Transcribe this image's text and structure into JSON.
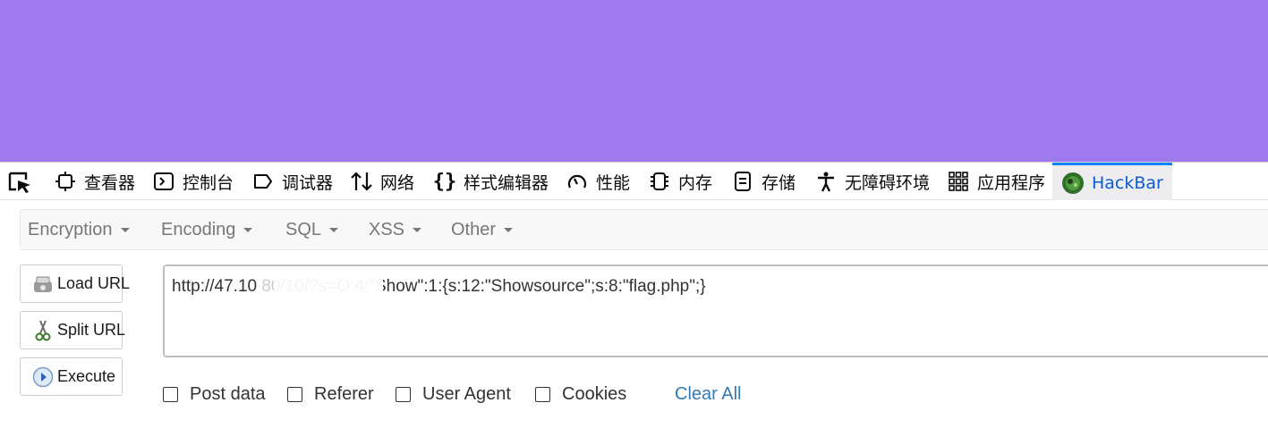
{
  "devtools": {
    "tabs": [
      {
        "label": "查看器",
        "icon": "inspector-icon"
      },
      {
        "label": "控制台",
        "icon": "console-icon"
      },
      {
        "label": "调试器",
        "icon": "debugger-icon"
      },
      {
        "label": "网络",
        "icon": "network-icon"
      },
      {
        "label": "样式编辑器",
        "icon": "style-editor-icon"
      },
      {
        "label": "性能",
        "icon": "performance-icon"
      },
      {
        "label": "内存",
        "icon": "memory-icon"
      },
      {
        "label": "存储",
        "icon": "storage-icon"
      },
      {
        "label": "无障碍环境",
        "icon": "accessibility-icon"
      },
      {
        "label": "应用程序",
        "icon": "application-icon"
      },
      {
        "label": "HackBar",
        "icon": "hackbar-icon",
        "active": true
      }
    ],
    "active_color": "#0a84ff"
  },
  "hackbar": {
    "menu": [
      {
        "label": "Encryption"
      },
      {
        "label": "Encoding"
      },
      {
        "label": "SQL"
      },
      {
        "label": "XSS"
      },
      {
        "label": "Other"
      }
    ],
    "buttons": {
      "load_url": "Load URL",
      "split_url": "Split URL",
      "execute": "Execute"
    },
    "url": "http://47.10        80/10/?s=O:4:\"Show\":1:{s:12:\"Showsource\";s:8:\"flag.php\";}",
    "options": {
      "post_data": "Post data",
      "referer": "Referer",
      "user_agent": "User Agent",
      "cookies": "Cookies"
    },
    "clear_all": "Clear All"
  },
  "colors": {
    "page_background": "#9f7aee",
    "link": "#337ab7"
  }
}
